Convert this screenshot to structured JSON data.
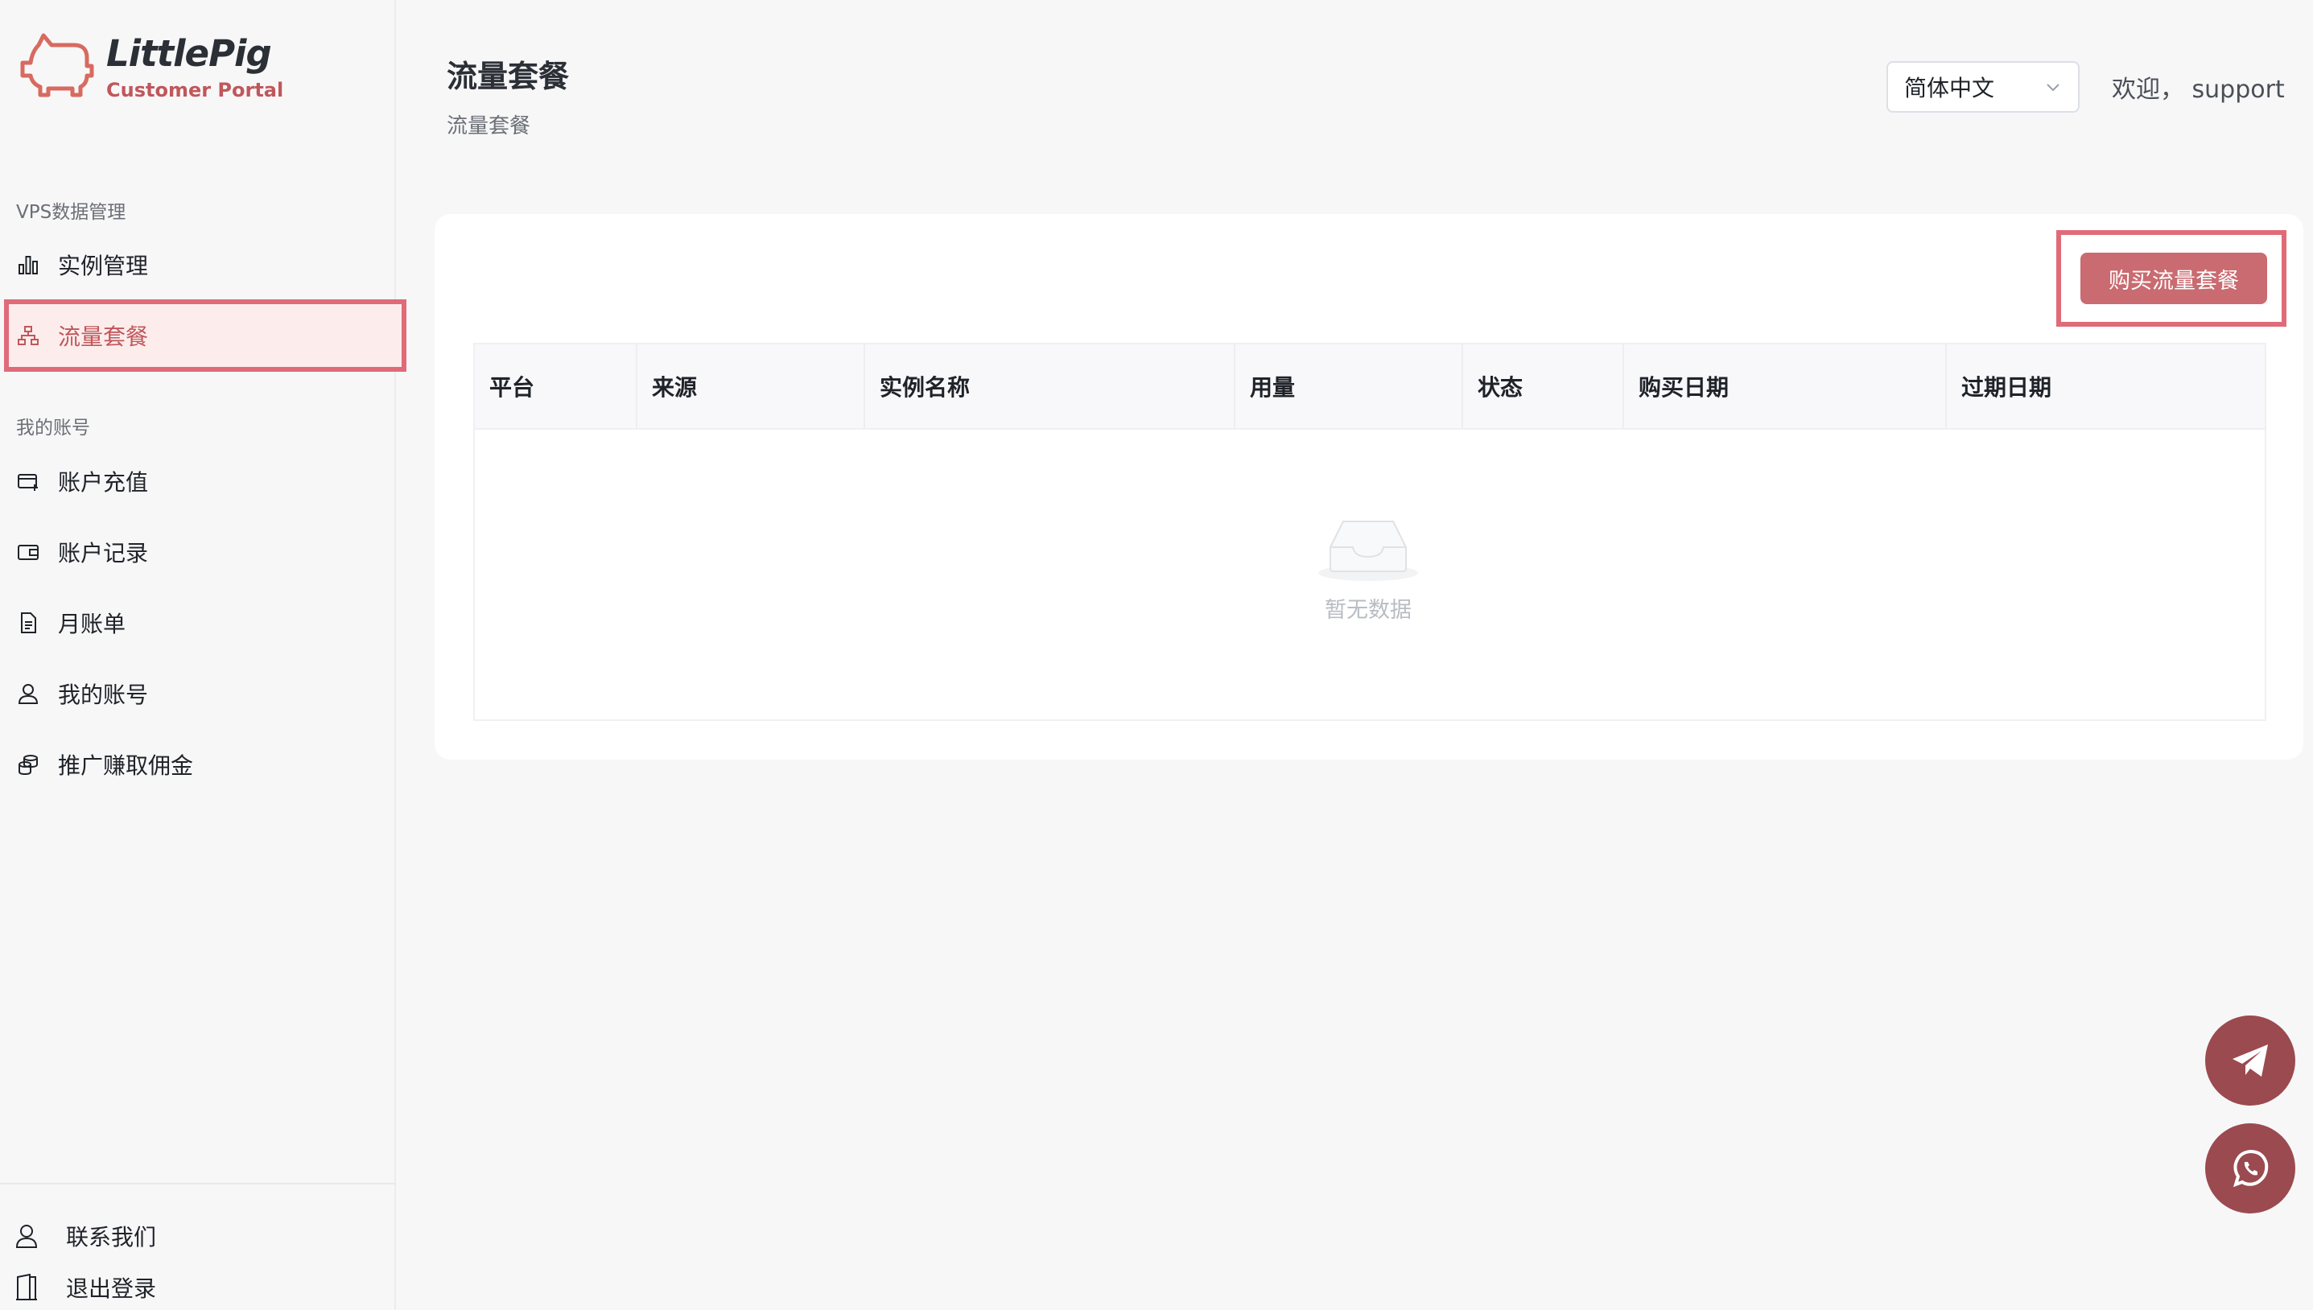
{
  "brand": {
    "title": "LittlePig",
    "subtitle": "Customer Portal"
  },
  "sidebar": {
    "sections": [
      {
        "label": "VPS数据管理"
      },
      {
        "label": "我的账号"
      }
    ],
    "items": [
      {
        "label": "实例管理",
        "icon": "bar-chart-icon"
      },
      {
        "label": "流量套餐",
        "icon": "sitemap-icon",
        "active": true
      },
      {
        "label": "账户充值",
        "icon": "card-add-icon"
      },
      {
        "label": "账户记录",
        "icon": "wallet-icon"
      },
      {
        "label": "月账单",
        "icon": "document-icon"
      },
      {
        "label": "我的账号",
        "icon": "user-icon"
      },
      {
        "label": "推广赚取佣金",
        "icon": "coins-icon"
      }
    ],
    "bottom": [
      {
        "label": "联系我们",
        "icon": "user-icon"
      },
      {
        "label": "退出登录",
        "icon": "door-icon"
      }
    ]
  },
  "header": {
    "title": "流量套餐",
    "breadcrumb": "流量套餐",
    "language": "简体中文",
    "welcome": "欢迎， support"
  },
  "main": {
    "buy_button": "购买流量套餐",
    "columns": [
      "平台",
      "来源",
      "实例名称",
      "用量",
      "状态",
      "购买日期",
      "过期日期"
    ],
    "empty_text": "暂无数据"
  },
  "colors": {
    "accent": "#c96b70",
    "highlight": "#e06b78",
    "fab": "#9b4a4f"
  }
}
